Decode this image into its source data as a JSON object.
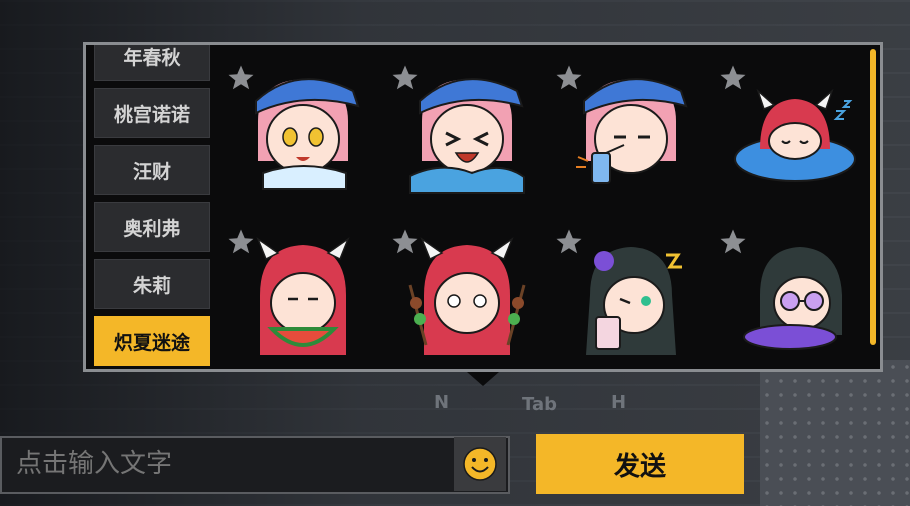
{
  "sticker_tabs": [
    {
      "label": "年春秋",
      "active": false
    },
    {
      "label": "桃宫诺诺",
      "active": false
    },
    {
      "label": "汪财",
      "active": false
    },
    {
      "label": "奥利弗",
      "active": false
    },
    {
      "label": "朱莉",
      "active": false
    },
    {
      "label": "炽夏迷途",
      "active": true
    }
  ],
  "stickers": [
    {
      "name": "pink-hair-cap-smile"
    },
    {
      "name": "pink-hair-cap-laugh"
    },
    {
      "name": "pink-hair-cap-drink"
    },
    {
      "name": "red-hair-horns-float-sleep"
    },
    {
      "name": "red-hair-horns-watermelon"
    },
    {
      "name": "red-hair-horns-skewers"
    },
    {
      "name": "dark-hair-angry-can"
    },
    {
      "name": "dark-hair-sunglasses-float"
    }
  ],
  "hud_hints": {
    "n": "N",
    "tab": "Tab",
    "h": "H"
  },
  "chat": {
    "input_placeholder": "点击输入文字",
    "send_label": "发送"
  },
  "colors": {
    "accent": "#f4b728",
    "panel": "#0b0b0c"
  }
}
